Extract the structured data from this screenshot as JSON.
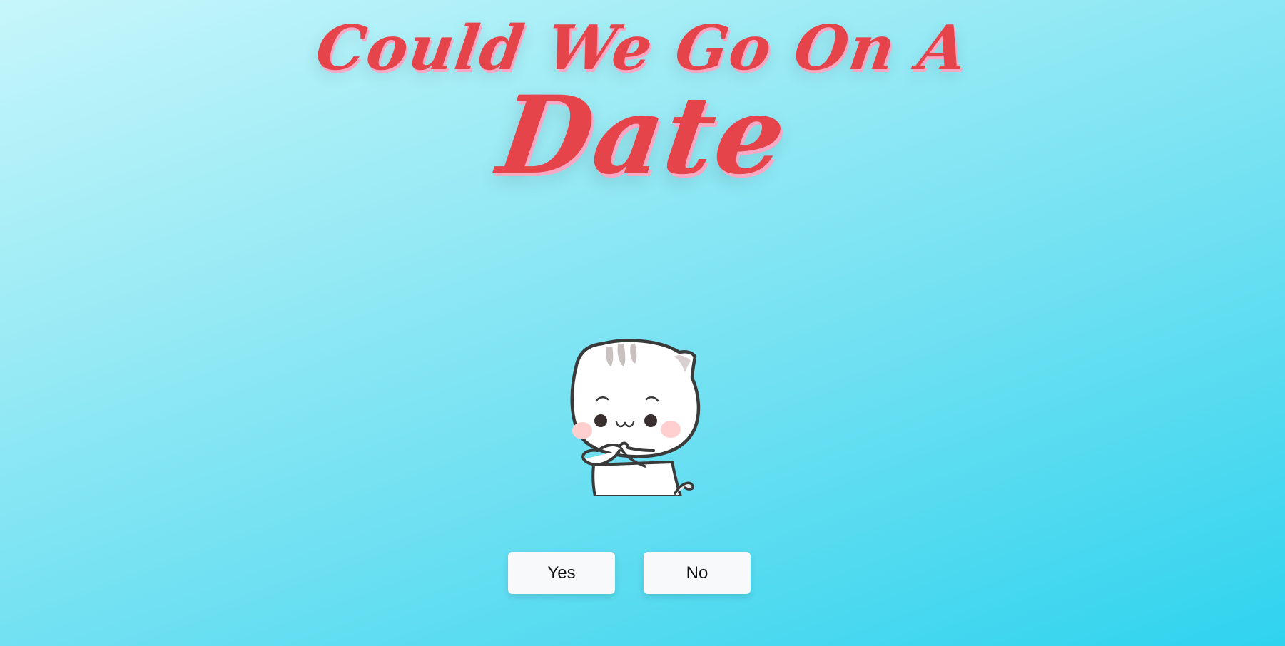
{
  "heading": {
    "line1": "Could We Go On A",
    "line2": "Date"
  },
  "cat_image": {
    "icon": "cat-praying-icon"
  },
  "buttons": {
    "yes_label": "Yes",
    "no_label": "No"
  },
  "colors": {
    "title": "#e5444b",
    "title_shadow": "#f7a8c4",
    "background_start": "#c6f6fb",
    "background_end": "#2fd3ee",
    "button_bg": "#f7f9fb"
  }
}
